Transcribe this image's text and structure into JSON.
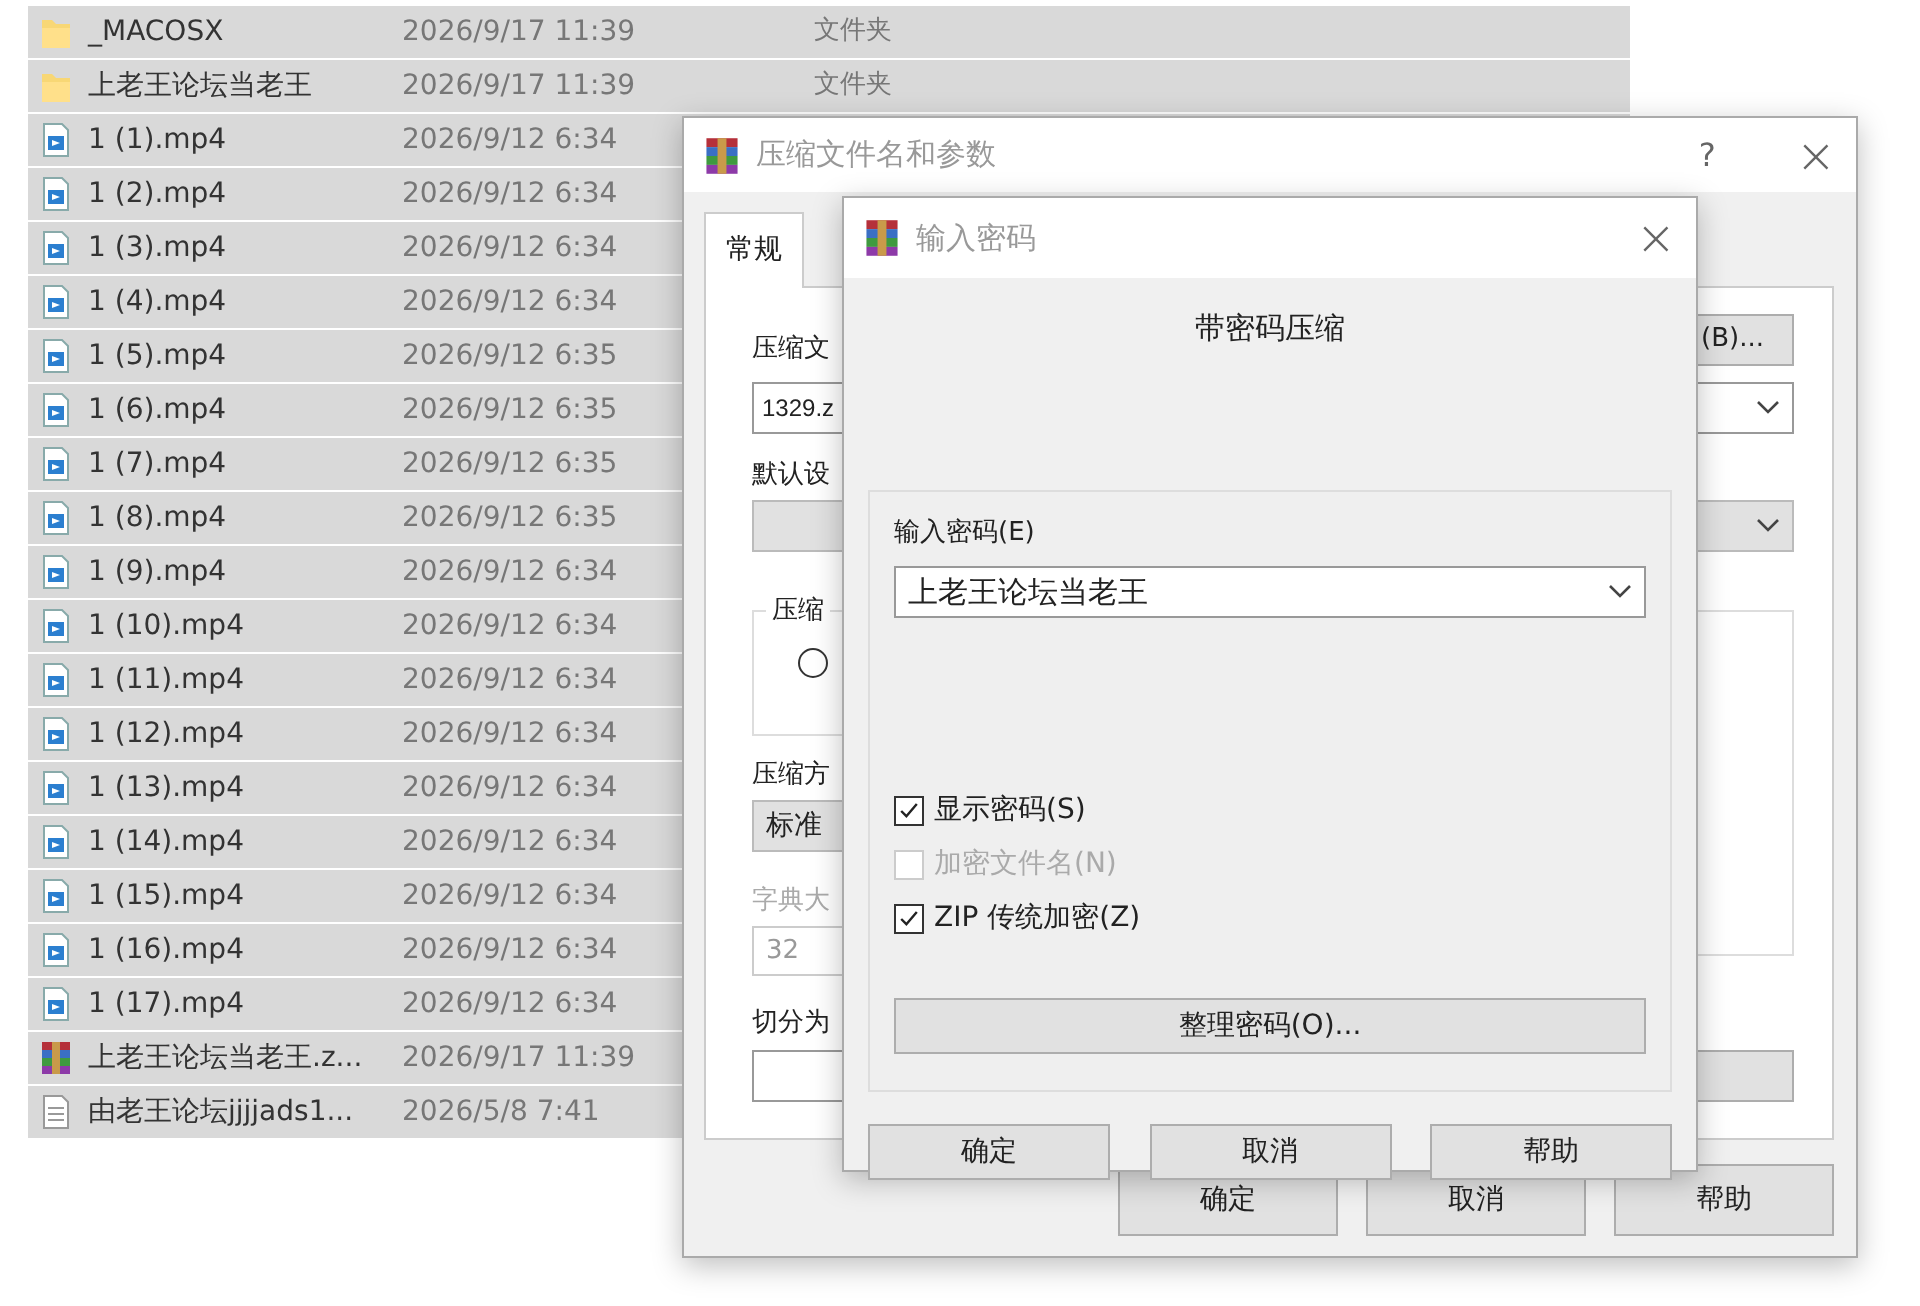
{
  "file_list": {
    "rows": [
      {
        "kind": "folder",
        "name": "_MACOSX",
        "modified": "2026/9/17 11:39",
        "type": "文件夹",
        "selected": true
      },
      {
        "kind": "folder",
        "name": "上老王论坛当老王",
        "modified": "2026/9/17 11:39",
        "type": "文件夹",
        "selected": true
      },
      {
        "kind": "video",
        "name": "1 (1).mp4",
        "modified": "2026/9/12 6:34",
        "selected": true
      },
      {
        "kind": "video",
        "name": "1 (2).mp4",
        "modified": "2026/9/12 6:34",
        "selected": true
      },
      {
        "kind": "video",
        "name": "1 (3).mp4",
        "modified": "2026/9/12 6:34",
        "selected": true
      },
      {
        "kind": "video",
        "name": "1 (4).mp4",
        "modified": "2026/9/12 6:34",
        "selected": true
      },
      {
        "kind": "video",
        "name": "1 (5).mp4",
        "modified": "2026/9/12 6:35",
        "selected": true
      },
      {
        "kind": "video",
        "name": "1 (6).mp4",
        "modified": "2026/9/12 6:35",
        "selected": true
      },
      {
        "kind": "video",
        "name": "1 (7).mp4",
        "modified": "2026/9/12 6:35",
        "selected": true
      },
      {
        "kind": "video",
        "name": "1 (8).mp4",
        "modified": "2026/9/12 6:35",
        "selected": true
      },
      {
        "kind": "video",
        "name": "1 (9).mp4",
        "modified": "2026/9/12 6:34",
        "selected": true
      },
      {
        "kind": "video",
        "name": "1 (10).mp4",
        "modified": "2026/9/12 6:34",
        "selected": true
      },
      {
        "kind": "video",
        "name": "1 (11).mp4",
        "modified": "2026/9/12 6:34",
        "selected": true
      },
      {
        "kind": "video",
        "name": "1 (12).mp4",
        "modified": "2026/9/12 6:34",
        "selected": true
      },
      {
        "kind": "video",
        "name": "1 (13).mp4",
        "modified": "2026/9/12 6:34",
        "selected": true
      },
      {
        "kind": "video",
        "name": "1 (14).mp4",
        "modified": "2026/9/12 6:34",
        "selected": true
      },
      {
        "kind": "video",
        "name": "1 (15).mp4",
        "modified": "2026/9/12 6:34",
        "selected": true
      },
      {
        "kind": "video",
        "name": "1 (16).mp4",
        "modified": "2026/9/12 6:34",
        "selected": true
      },
      {
        "kind": "video",
        "name": "1 (17).mp4",
        "modified": "2026/9/12 6:34",
        "selected": true
      },
      {
        "kind": "archive",
        "name": "上老王论坛当老王.z...",
        "modified": "2026/9/17 11:39",
        "selected": true
      },
      {
        "kind": "text",
        "name": "由老王论坛jjjjads1...",
        "modified": "2026/5/8 7:41",
        "selected": true
      }
    ]
  },
  "archive_dialog": {
    "title": "压缩文件名和参数",
    "help": "?",
    "close": "×",
    "tabs": [
      {
        "label": "常规",
        "selected": true
      }
    ],
    "archive_name_label": "压缩文",
    "browse_button": "(B)...",
    "archive_name_value": "1329.z",
    "profile_label": "默认设",
    "format_group_label": "压缩",
    "format_radio": {
      "selected": false
    },
    "method_label": "压缩方",
    "method_value": "标准",
    "dictionary_label": "字典大",
    "dictionary_value": "32",
    "split_label": "切分为",
    "buttons": [
      "确定",
      "取消",
      "帮助"
    ]
  },
  "password_dialog": {
    "title": "输入密码",
    "close": "×",
    "heading": "带密码压缩",
    "password_label": "输入密码(E)",
    "password_value": "上老王论坛当老王",
    "options": [
      {
        "label": "显示密码(S)",
        "checked": true,
        "disabled": false
      },
      {
        "label": "加密文件名(N)",
        "checked": false,
        "disabled": true
      },
      {
        "label": "ZIP 传统加密(Z)",
        "checked": true,
        "disabled": false
      }
    ],
    "organize_button": "整理密码(O)...",
    "buttons": [
      "确定",
      "取消",
      "帮助"
    ]
  }
}
